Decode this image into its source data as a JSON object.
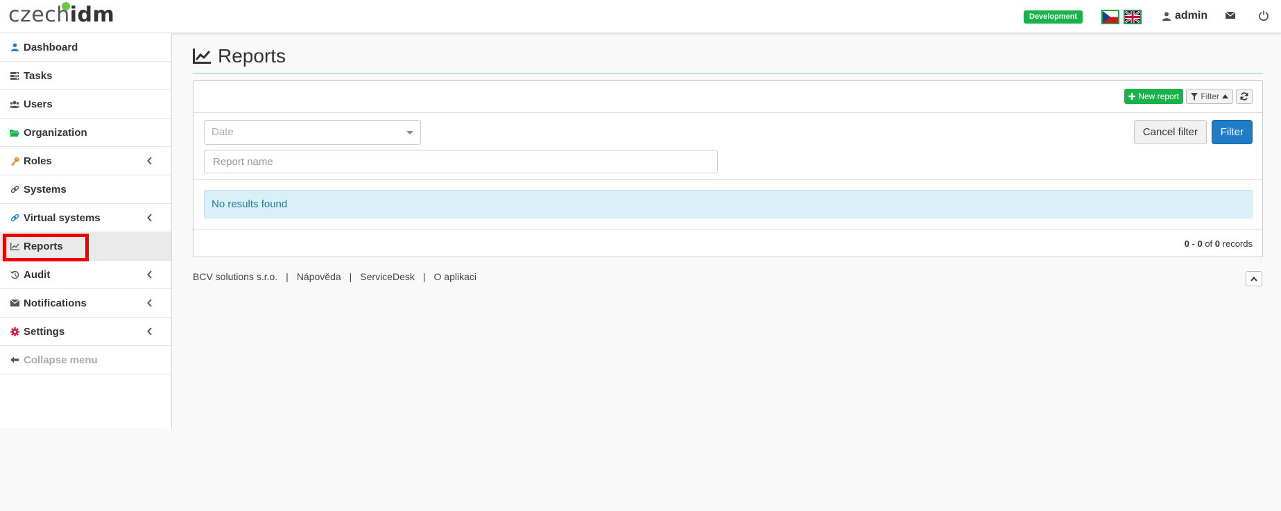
{
  "app": {
    "logo_text_main": "czech",
    "logo_text_accent": "idm",
    "environment": "Development",
    "user": "admin",
    "languages": [
      "cs",
      "en"
    ]
  },
  "sidebar": {
    "items": [
      {
        "label": "Dashboard",
        "icon": "user-icon",
        "icon_color": "#1f7cc6",
        "chevron": false
      },
      {
        "label": "Tasks",
        "icon": "tasks-icon",
        "icon_color": "#555555",
        "chevron": false
      },
      {
        "label": "Users",
        "icon": "users-icon",
        "icon_color": "#555555",
        "chevron": false
      },
      {
        "label": "Organization",
        "icon": "folder-open-icon",
        "icon_color": "#18b34a",
        "chevron": false
      },
      {
        "label": "Roles",
        "icon": "key-icon",
        "icon_color": "#e5901a",
        "chevron": true
      },
      {
        "label": "Systems",
        "icon": "link-icon",
        "icon_color": "#555555",
        "chevron": false
      },
      {
        "label": "Virtual systems",
        "icon": "link-icon",
        "icon_color": "#1f7cc6",
        "chevron": true
      },
      {
        "label": "Reports",
        "icon": "line-chart-icon",
        "icon_color": "#555555",
        "chevron": false
      },
      {
        "label": "Audit",
        "icon": "history-icon",
        "icon_color": "#555555",
        "chevron": true
      },
      {
        "label": "Notifications",
        "icon": "envelope-icon",
        "icon_color": "#555555",
        "chevron": true
      },
      {
        "label": "Settings",
        "icon": "gear-icon",
        "icon_color": "#d9143c",
        "chevron": true
      },
      {
        "label": "Collapse menu",
        "icon": "arrow-left-icon",
        "icon_color": "#555555",
        "chevron": false
      }
    ]
  },
  "main": {
    "title": "Reports",
    "toolbar": {
      "new_report": "New report",
      "filter_toggle": "Filter"
    },
    "filter": {
      "date_placeholder": "Date",
      "report_name_placeholder": "Report name",
      "cancel_label": "Cancel filter",
      "apply_label": "Filter"
    },
    "results": {
      "empty_message": "No results found",
      "pager_from": "0",
      "pager_to": "0",
      "pager_of": "of",
      "pager_total": "0",
      "pager_suffix": "records"
    }
  },
  "footer": {
    "links": [
      "BCV solutions s.r.o.",
      "Nápověda",
      "ServiceDesk",
      "O aplikaci"
    ]
  },
  "colors": {
    "accent_green": "#18b34a",
    "primary_blue": "#1f7cc6",
    "highlight_red": "#ee0000"
  }
}
